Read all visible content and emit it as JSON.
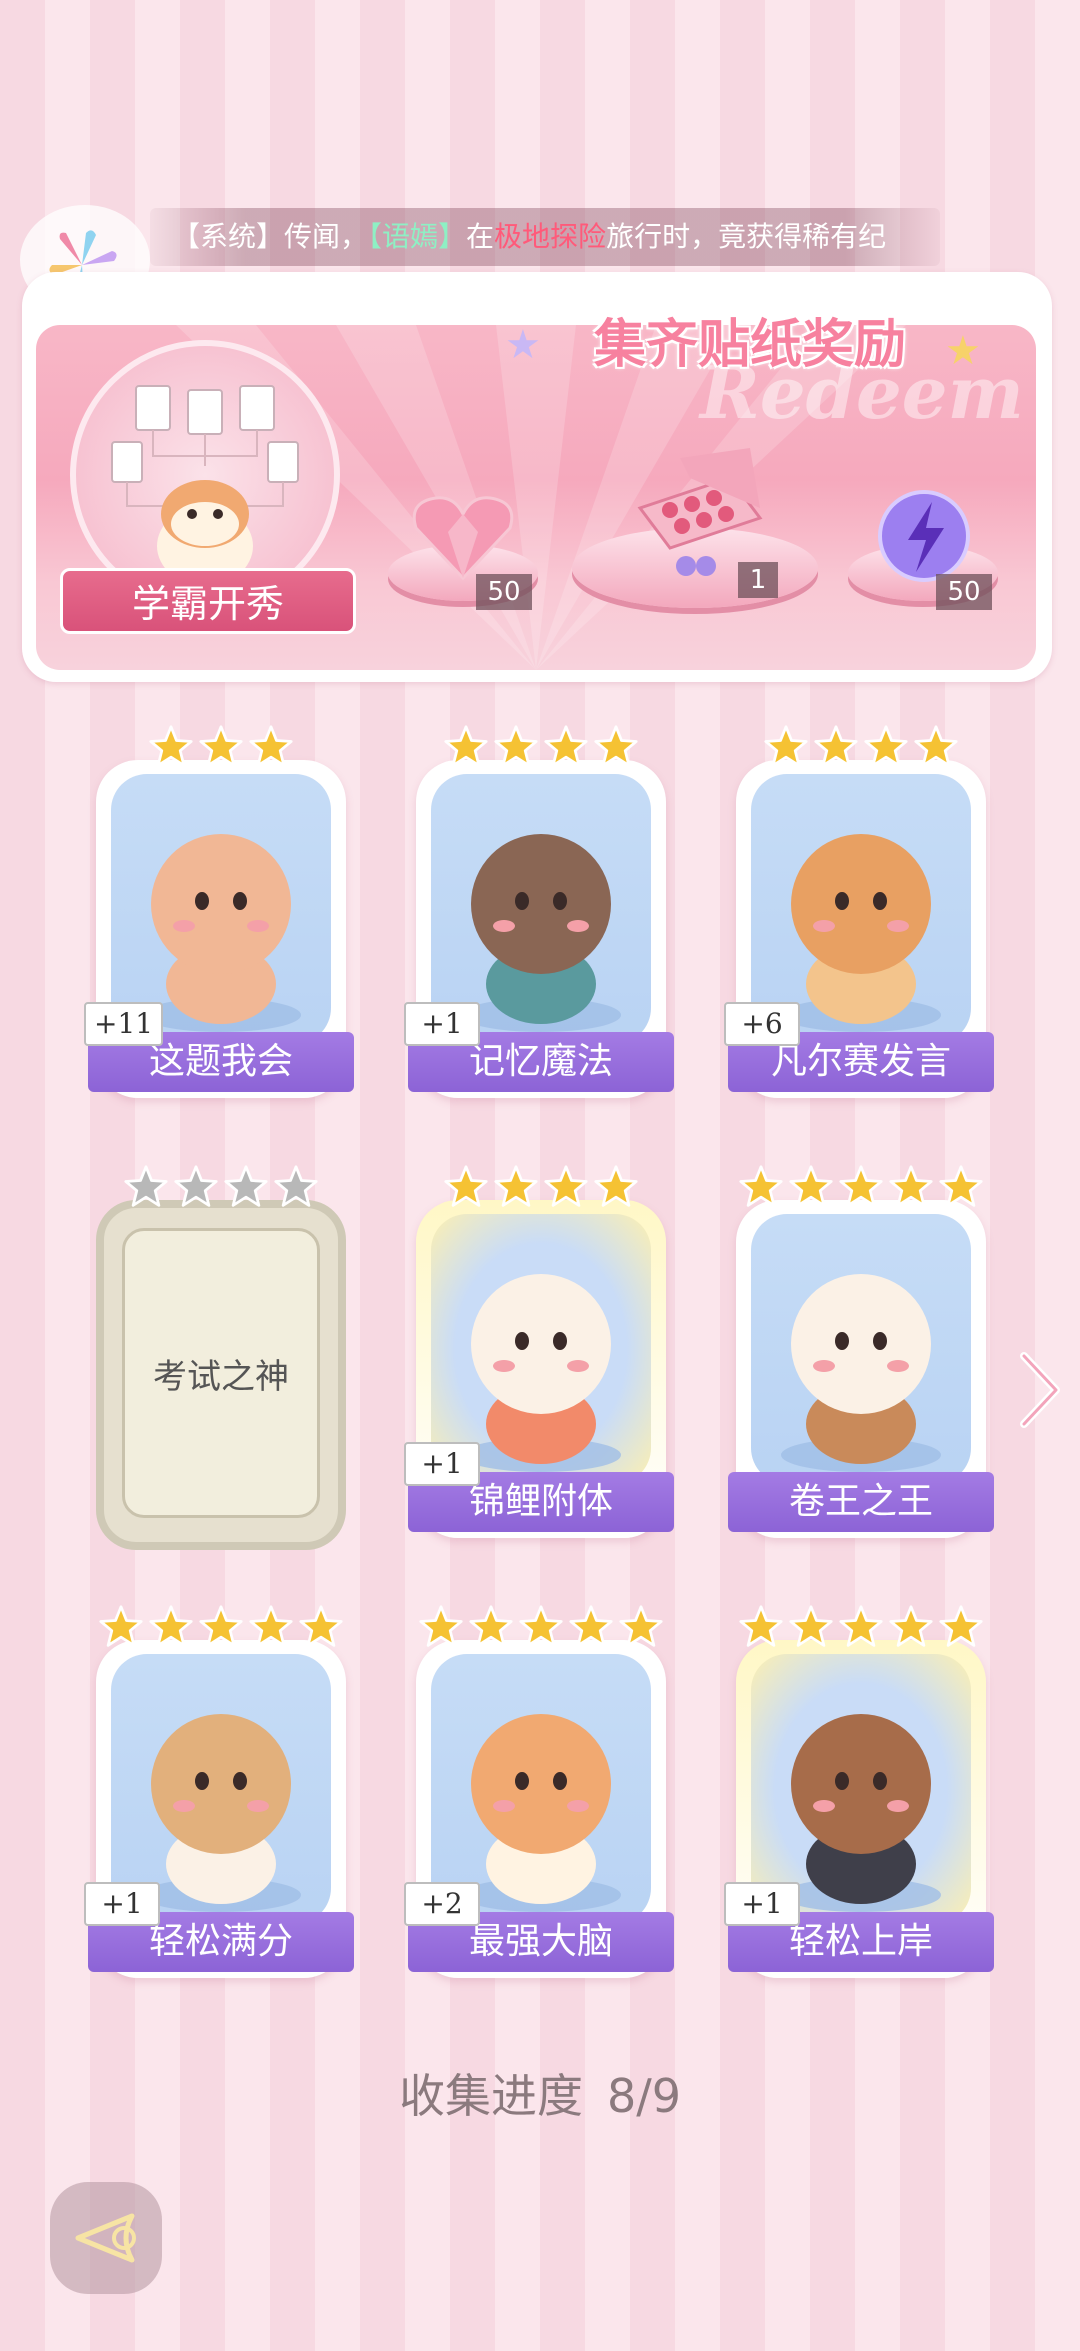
{
  "ticker": {
    "prefix": "【系统】传闻，",
    "user": "【语嫣】",
    "mid": "在",
    "place": "极地探险",
    "suffix": "旅行时，竟获得稀有纪"
  },
  "banner": {
    "title": "集齐贴纸奖励",
    "watermark": "Redeem",
    "badge_label": "学霸开秀",
    "rewards": [
      {
        "name": "pink-heart-gem",
        "count": "50"
      },
      {
        "name": "gift-box",
        "count": "1"
      },
      {
        "name": "purple-energy-orb",
        "count": "50"
      }
    ]
  },
  "cards": [
    {
      "label": "这题我会",
      "count": "+11",
      "stars": 3,
      "collected": true,
      "gold": false
    },
    {
      "label": "记忆魔法",
      "count": "+1",
      "stars": 4,
      "collected": true,
      "gold": false
    },
    {
      "label": "凡尔赛发言",
      "count": "+6",
      "stars": 4,
      "collected": true,
      "gold": false
    },
    {
      "label": "考试之神",
      "count": "",
      "stars": 4,
      "collected": false,
      "gold": false
    },
    {
      "label": "锦鲤附体",
      "count": "+1",
      "stars": 4,
      "collected": true,
      "gold": true
    },
    {
      "label": "卷王之王",
      "count": "",
      "stars": 5,
      "collected": true,
      "gold": false
    },
    {
      "label": "轻松满分",
      "count": "+1",
      "stars": 5,
      "collected": true,
      "gold": false
    },
    {
      "label": "最强大脑",
      "count": "+2",
      "stars": 5,
      "collected": true,
      "gold": false
    },
    {
      "label": "轻松上岸",
      "count": "+1",
      "stars": 5,
      "collected": true,
      "gold": true
    }
  ],
  "progress": {
    "label": "收集进度",
    "value": "8/9"
  },
  "colors": {
    "accent_purple": "#9b72e0",
    "banner_pink": "#f7a9bd",
    "star_gold": "#f5c233",
    "star_grey": "#b8b8b8"
  }
}
